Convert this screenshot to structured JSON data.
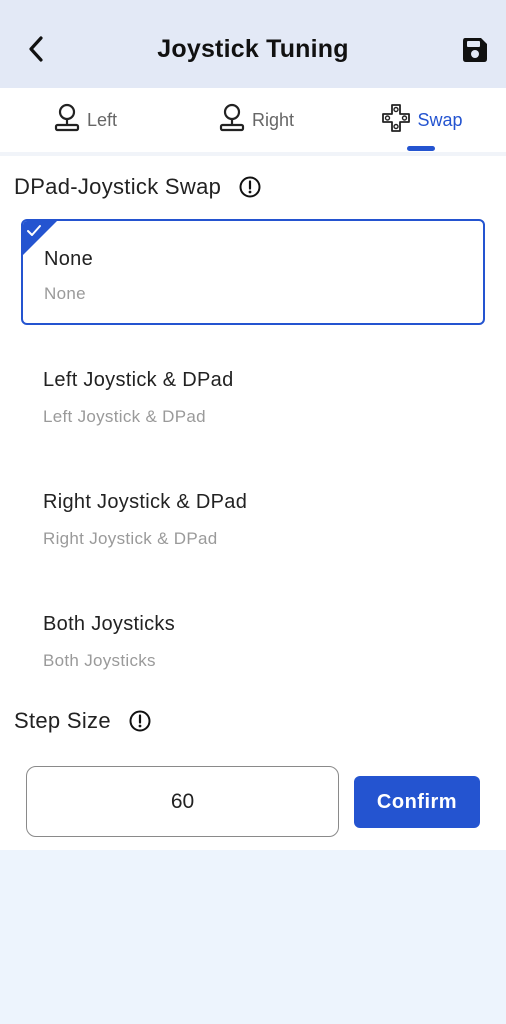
{
  "header": {
    "title": "Joystick Tuning",
    "back_icon": "chevron-left-icon",
    "save_icon": "floppy-disk-icon"
  },
  "tabs": [
    {
      "label": "Left",
      "icon": "joystick-icon",
      "active": false
    },
    {
      "label": "Right",
      "icon": "joystick-icon",
      "active": false
    },
    {
      "label": "Swap",
      "icon": "dpad-icon",
      "active": true
    }
  ],
  "swap_section": {
    "title": "DPad-Joystick Swap",
    "options": [
      {
        "title": "None",
        "subtitle": "None",
        "selected": true
      },
      {
        "title": "Left Joystick & DPad",
        "subtitle": "Left Joystick & DPad",
        "selected": false
      },
      {
        "title": "Right Joystick & DPad",
        "subtitle": "Right Joystick & DPad",
        "selected": false
      },
      {
        "title": "Both Joysticks",
        "subtitle": "Both Joysticks",
        "selected": false
      }
    ]
  },
  "step_section": {
    "title": "Step Size",
    "value": "60",
    "confirm_label": "Confirm"
  },
  "colors": {
    "accent": "#2454d0",
    "header_bg": "#e3e9f6",
    "page_bg": "#edf4fd"
  }
}
